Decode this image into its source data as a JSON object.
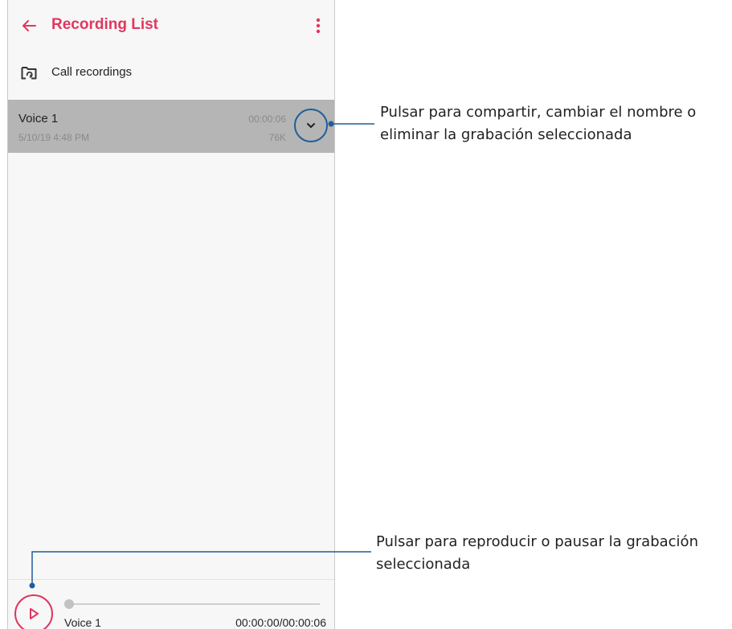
{
  "appbar": {
    "title": "Recording List",
    "back_icon": "arrow-left-icon",
    "menu_icon": "more-vertical-icon"
  },
  "folder": {
    "label": "Call recordings",
    "icon": "folder-sync-icon"
  },
  "recordings": [
    {
      "name": "Voice 1",
      "date": "5/10/19 4:48 PM",
      "duration": "00:00:06",
      "size": "76K",
      "selected": true
    }
  ],
  "player": {
    "name": "Voice 1",
    "time": "00:00:00/00:00:06",
    "progress": 0
  },
  "callouts": {
    "expand_line1": "Pulsar para compartir, cambiar el nombre o",
    "expand_line2": "eliminar la grabación seleccionada",
    "play_line1": "Pulsar para reproducir o pausar la grabación",
    "play_line2": "seleccionada"
  },
  "colors": {
    "accent": "#e0375f",
    "callout_line": "#1f5e9a",
    "selected_row": "#b5b5b5",
    "background": "#f7f7f7"
  }
}
